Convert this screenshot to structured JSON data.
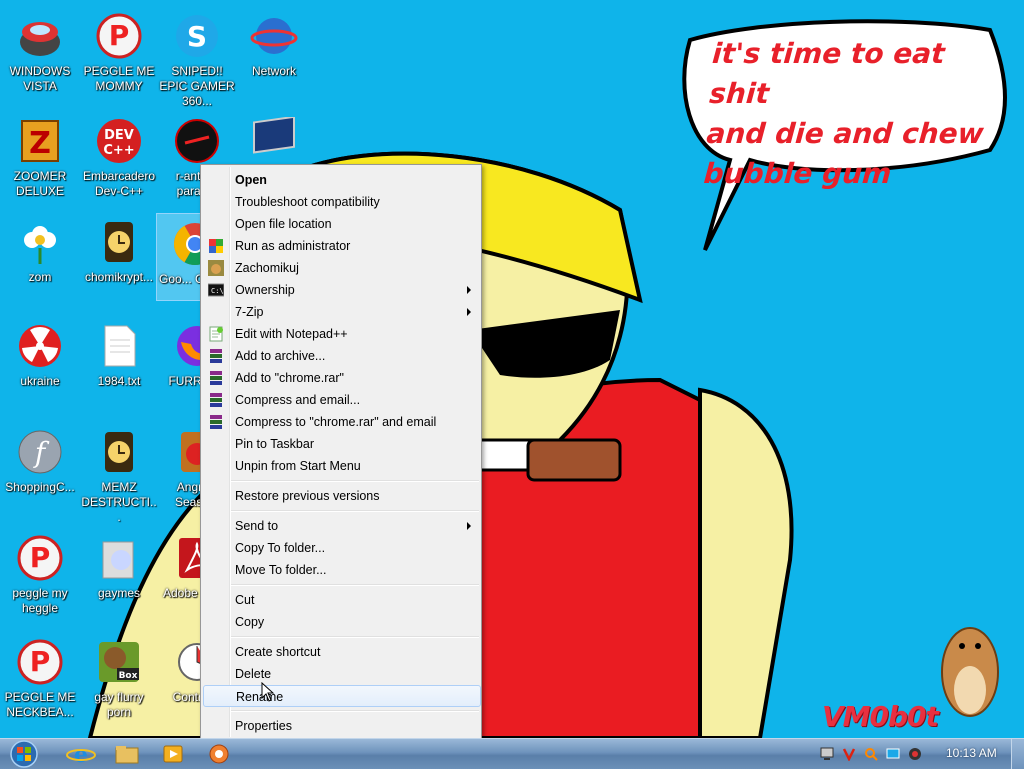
{
  "desktop": {
    "speech_bubble": [
      "it's time to eat shit",
      "and die and chew",
      "bubble gum"
    ],
    "watermark": "VM0b0t"
  },
  "icons": [
    {
      "label": "WINDOWS VISTA",
      "icon": "vista-bowl-icon"
    },
    {
      "label": "PEGGLE ME MOMMY",
      "icon": "peggle-icon"
    },
    {
      "label": "SNIPED!! EPIC GAMER 360...",
      "icon": "skype-icon"
    },
    {
      "label": "Network",
      "icon": "network-icon"
    },
    {
      "label": "ZOOMER DELUXE",
      "icon": "zoomer-icon"
    },
    {
      "label": "Embarcadero Dev-C++",
      "icon": "devcpp-icon"
    },
    {
      "label": "r-antiv... parad...",
      "icon": "rantivirus-icon"
    },
    {
      "label": "",
      "icon": "monitor-icon"
    },
    {
      "label": "zom",
      "icon": "flower-icon"
    },
    {
      "label": "chomikrypt...",
      "icon": "clock-doc-icon"
    },
    {
      "label": "Goo... Chro...",
      "icon": "chrome-icon"
    },
    {
      "label": "ukraine",
      "icon": "radiation-icon"
    },
    {
      "label": "1984.txt",
      "icon": "text-file-icon"
    },
    {
      "label": "FURRYF...",
      "icon": "firefox-icon"
    },
    {
      "label": "ShoppingC...",
      "icon": "flash-icon"
    },
    {
      "label": "MEMZ DESTRUCTI...",
      "icon": "clock-doc-icon"
    },
    {
      "label": "Angry... Seaso...",
      "icon": "angry-birds-icon"
    },
    {
      "label": "peggle my heggle",
      "icon": "peggle-icon"
    },
    {
      "label": "gaymes",
      "icon": "folder-icon"
    },
    {
      "label": "Adobe R... X",
      "icon": "adobe-reader-icon"
    },
    {
      "label": "PEGGLE ME NECKBEA...",
      "icon": "peggle-icon"
    },
    {
      "label": "gay flurry porn",
      "icon": "beaver-box-icon"
    },
    {
      "label": "Control...",
      "icon": "control-panel-icon"
    }
  ],
  "context_menu": {
    "items": [
      {
        "label": "Open",
        "bold": true
      },
      {
        "label": "Troubleshoot compatibility"
      },
      {
        "label": "Open file location"
      },
      {
        "label": "Run as administrator",
        "icon": "shield-icon"
      },
      {
        "label": "Zachomikuj",
        "icon": "hamster-icon"
      },
      {
        "label": "Ownership",
        "icon": "cmd-icon",
        "submenu": true
      },
      {
        "label": "7-Zip",
        "submenu": true
      },
      {
        "label": "Edit with Notepad++",
        "icon": "notepadpp-icon"
      },
      {
        "label": "Add to archive...",
        "icon": "winrar-icon"
      },
      {
        "label": "Add to \"chrome.rar\"",
        "icon": "winrar-icon"
      },
      {
        "label": "Compress and email...",
        "icon": "winrar-icon"
      },
      {
        "label": "Compress to \"chrome.rar\" and email",
        "icon": "winrar-icon"
      },
      {
        "label": "Pin to Taskbar"
      },
      {
        "label": "Unpin from Start Menu"
      },
      {
        "label": "Restore previous versions"
      },
      {
        "label": "Send to",
        "submenu": true
      },
      {
        "label": "Copy To folder..."
      },
      {
        "label": "Move To folder..."
      },
      {
        "label": "Cut"
      },
      {
        "label": "Copy"
      },
      {
        "label": "Create shortcut"
      },
      {
        "label": "Delete"
      },
      {
        "label": "Rename",
        "hover": true
      },
      {
        "label": "Properties"
      }
    ]
  },
  "taskbar": {
    "pinned": [
      "internet-explorer-icon",
      "explorer-folder-icon",
      "media-player-icon",
      "app-icon"
    ],
    "tray": [
      "network-tray-icon",
      "antivirus-tray-icon",
      "search-tray-icon",
      "display-tray-icon",
      "volume-tray-icon"
    ],
    "clock": "10:13 AM"
  }
}
